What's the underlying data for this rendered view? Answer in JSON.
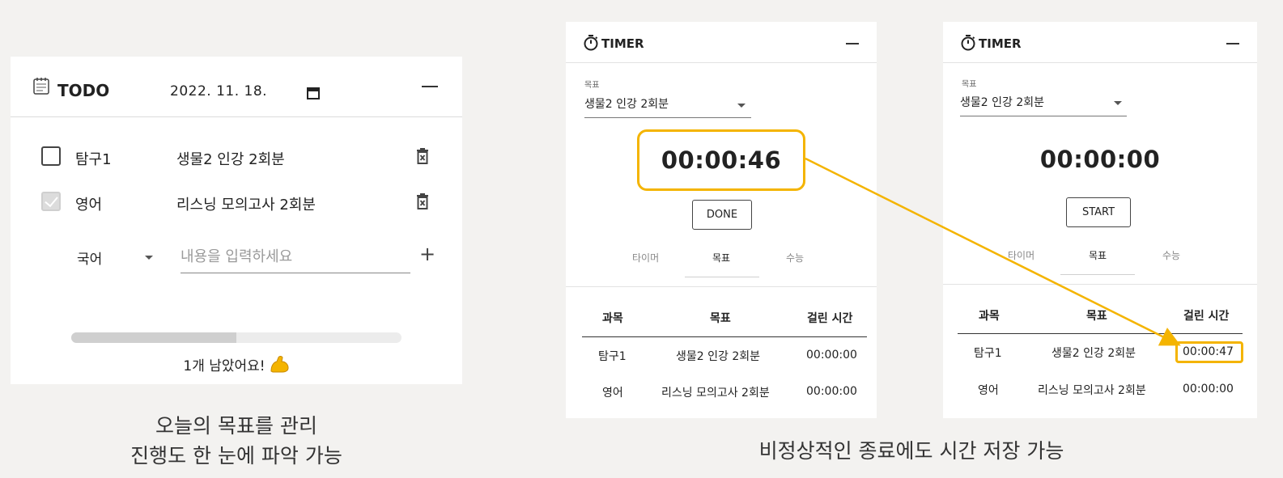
{
  "todo": {
    "title": "TODO",
    "date": "2022. 11. 18.",
    "items": [
      {
        "subject": "탐구1",
        "task": "생물2 인강 2회분",
        "done": false
      },
      {
        "subject": "영어",
        "task": "리스닝 모의고사 2회분",
        "done": true
      }
    ],
    "new_subject": "국어",
    "input_placeholder": "내용을 입력하세요",
    "progress": 0.5,
    "remaining_text": "1개 남았어요!"
  },
  "caption_left_1": "오늘의 목표를 관리",
  "caption_left_2": "진행도 한 눈에 파악 가능",
  "caption_right": "비정상적인 종료에도 시간 저장 가능",
  "timer1": {
    "title": "TIMER",
    "goal_label": "목표",
    "goal_value": "생물2 인강 2회분",
    "time": "00:00:46",
    "button": "DONE",
    "tabs": [
      "타이머",
      "목표",
      "수능"
    ],
    "columns": [
      "과목",
      "목표",
      "걸린 시간"
    ],
    "rows": [
      {
        "subject": "탐구1",
        "goal": "생물2 인강 2회분",
        "time": "00:00:00"
      },
      {
        "subject": "영어",
        "goal": "리스닝 모의고사 2회분",
        "time": "00:00:00"
      }
    ]
  },
  "timer2": {
    "title": "TIMER",
    "goal_label": "목표",
    "goal_value": "생물2 인강 2회분",
    "time": "00:00:00",
    "button": "START",
    "tabs": [
      "타이머",
      "목표",
      "수능"
    ],
    "columns": [
      "과목",
      "목표",
      "걸린 시간"
    ],
    "rows": [
      {
        "subject": "탐구1",
        "goal": "생물2 인강 2회분",
        "time": "00:00:47"
      },
      {
        "subject": "영어",
        "goal": "리스닝 모의고사 2회분",
        "time": "00:00:00"
      }
    ]
  },
  "colors": {
    "highlight": "#f4b400"
  }
}
